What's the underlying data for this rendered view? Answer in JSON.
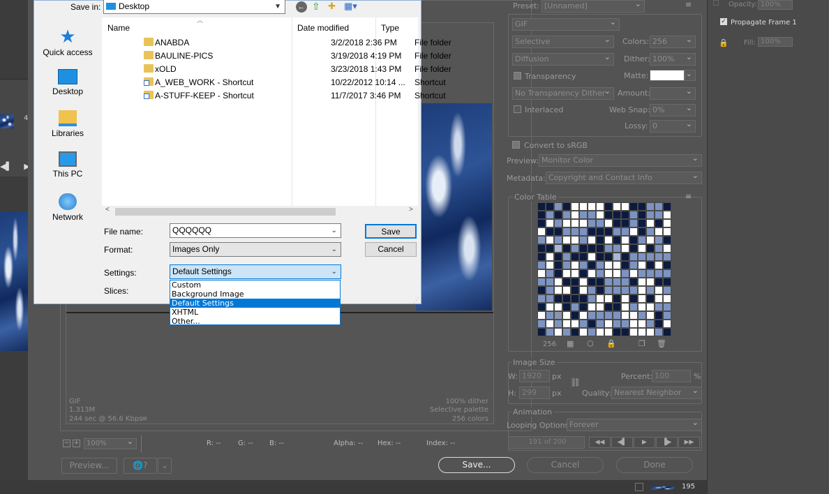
{
  "file_dialog": {
    "save_in_label": "Save in:",
    "save_in_value": "Desktop",
    "places": [
      {
        "label": "Quick access"
      },
      {
        "label": "Desktop"
      },
      {
        "label": "Libraries"
      },
      {
        "label": "This PC"
      },
      {
        "label": "Network"
      }
    ],
    "columns": {
      "name": "Name",
      "date": "Date modified",
      "type": "Type"
    },
    "files": [
      {
        "name": "ANABDA",
        "date": "3/2/2018 2:36 PM",
        "type": "File folder"
      },
      {
        "name": "BAULINE-PICS",
        "date": "3/19/2018 4:19 PM",
        "type": "File folder"
      },
      {
        "name": "xOLD",
        "date": "3/23/2018 1:43 PM",
        "type": "File folder"
      },
      {
        "name": "A_WEB_WORK - Shortcut",
        "date": "10/22/2012 10:14 ...",
        "type": "Shortcut"
      },
      {
        "name": "A-STUFF-KEEP - Shortcut",
        "date": "11/7/2017 3:46 PM",
        "type": "Shortcut"
      }
    ],
    "file_name_label": "File name:",
    "file_name_value": "QQQQQQ",
    "format_label": "Format:",
    "format_value": "Images Only",
    "settings_label": "Settings:",
    "settings_value": "Default Settings",
    "slices_label": "Slices:",
    "save_button": "Save",
    "cancel_button": "Cancel",
    "settings_options": [
      "Custom",
      "Background Image",
      "Default Settings",
      "XHTML",
      "Other..."
    ],
    "settings_selected_index": 2
  },
  "preview_status": {
    "format": "GIF",
    "size": "1.313M",
    "speed": "244 sec @ 56.6 Kbps",
    "dither": "100% dither",
    "palette": "Selective palette",
    "colors": "256 colors"
  },
  "bottom_bar": {
    "zoom": "100%",
    "r": "R: --",
    "g": "G: --",
    "b": "B: --",
    "alpha": "Alpha: --",
    "hex": "Hex: --",
    "index": "Index: --",
    "preview_button": "Preview...",
    "save_button": "Save...",
    "cancel_button": "Cancel",
    "done_button": "Done"
  },
  "settings_panel": {
    "preset_label": "Preset:",
    "preset_value": "[Unnamed]",
    "format_value": "GIF",
    "reduction_value": "Selective",
    "colors_label": "Colors:",
    "colors_value": "256",
    "dither_algo": "Diffusion",
    "dither_label": "Dither:",
    "dither_value": "100%",
    "transparency_label": "Transparency",
    "matte_label": "Matte:",
    "transparency_dither": "No Transparency Dither",
    "amount_label": "Amount:",
    "interlaced_label": "Interlaced",
    "web_snap_label": "Web Snap:",
    "web_snap_value": "0%",
    "lossy_label": "Lossy:",
    "lossy_value": "0",
    "convert_srgb_label": "Convert to sRGB",
    "preview_label": "Preview:",
    "preview_value": "Monitor Color",
    "metadata_label": "Metadata:",
    "metadata_value": "Copyright and Contact Info",
    "color_table_label": "Color Table",
    "color_count": "256",
    "image_size_label": "Image Size",
    "w_label": "W:",
    "w_value": "1920",
    "h_label": "H:",
    "h_value": "299",
    "px": "px",
    "percent_label": "Percent:",
    "percent_value": "100",
    "percent_unit": "%",
    "quality_label": "Quality:",
    "quality_value": "Nearest Neighbor",
    "animation_label": "Animation",
    "looping_label": "Looping Options:",
    "looping_value": "Forever",
    "frame_counter": "191 of 200"
  },
  "layers_panel": {
    "opacity_label": "Opacity:",
    "opacity_value": "100%",
    "propagate_label": "Propagate Frame 1",
    "fill_label": "Fill:",
    "fill_value": "100%",
    "frame_number": "195"
  },
  "left_strip": {
    "frame_label": "4"
  }
}
